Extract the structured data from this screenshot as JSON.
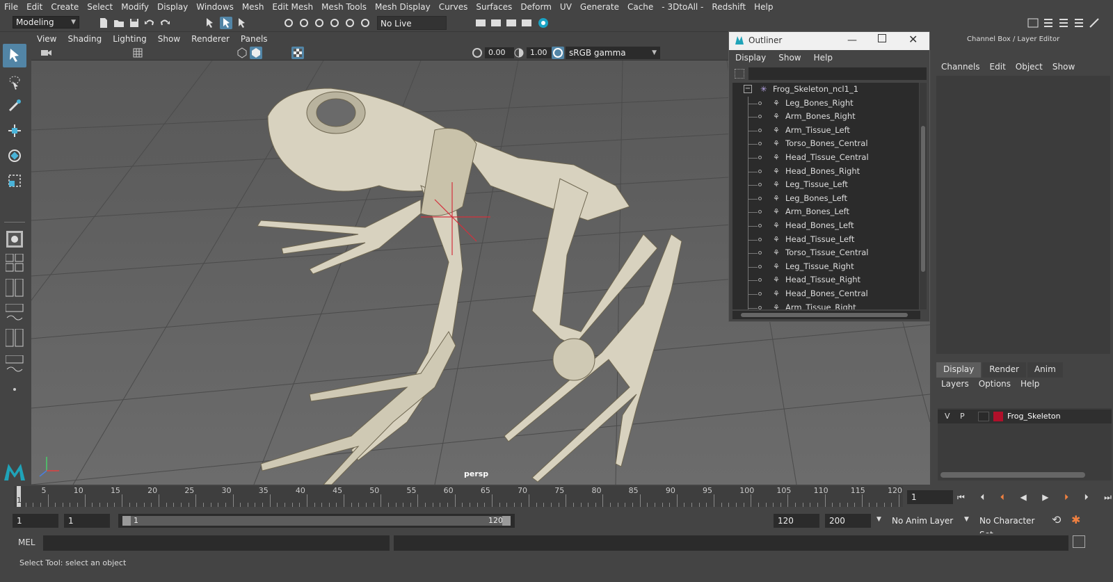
{
  "menubar": [
    "File",
    "Edit",
    "Create",
    "Select",
    "Modify",
    "Display",
    "Windows",
    "Mesh",
    "Edit Mesh",
    "Mesh Tools",
    "Mesh Display",
    "Curves",
    "Surfaces",
    "Deform",
    "UV",
    "Generate",
    "Cache",
    "- 3DtoAll -",
    "Redshift",
    "Help"
  ],
  "shelf": {
    "mode": "Modeling",
    "live_surface": "No Live Surface"
  },
  "viewport": {
    "menu": [
      "View",
      "Shading",
      "Lighting",
      "Show",
      "Renderer",
      "Panels"
    ],
    "exposure": "0.00",
    "gamma": "1.00",
    "color_space": "sRGB gamma",
    "camera_label": "persp"
  },
  "outliner": {
    "title": "Outliner",
    "menu": [
      "Display",
      "Show",
      "Help"
    ],
    "root": "Frog_Skeleton_ncl1_1",
    "items": [
      "Leg_Bones_Right",
      "Arm_Bones_Right",
      "Arm_Tissue_Left",
      "Torso_Bones_Central",
      "Head_Tissue_Central",
      "Head_Bones_Right",
      "Leg_Tissue_Left",
      "Leg_Bones_Left",
      "Arm_Bones_Left",
      "Head_Bones_Left",
      "Head_Tissue_Left",
      "Torso_Tissue_Central",
      "Leg_Tissue_Right",
      "Head_Tissue_Right",
      "Head_Bones_Central",
      "Arm_Tissue_Right"
    ]
  },
  "channel_box": {
    "title": "Channel Box / Layer Editor",
    "menu": [
      "Channels",
      "Edit",
      "Object",
      "Show"
    ],
    "tabs": [
      "Display",
      "Render",
      "Anim"
    ],
    "layer_menu": [
      "Layers",
      "Options",
      "Help"
    ],
    "layer": {
      "v": "V",
      "p": "P",
      "name": "Frog_Skeleton",
      "color": "#b0102a"
    }
  },
  "timeline": {
    "ticks": [
      "5",
      "10",
      "15",
      "20",
      "25",
      "30",
      "35",
      "40",
      "45",
      "50",
      "55",
      "60",
      "65",
      "70",
      "75",
      "80",
      "85",
      "90",
      "95",
      "100",
      "105",
      "110",
      "115",
      "120"
    ],
    "start_mark": "1",
    "current_frame": "1"
  },
  "range": {
    "start": "1",
    "playback_start": "1",
    "slider_start": "1",
    "slider_end": "120",
    "playback_end": "120",
    "end": "200",
    "anim_layer": "No Anim Layer",
    "character_set": "No Character Set"
  },
  "command": {
    "label": "MEL"
  },
  "status": {
    "text": "Select Tool: select an object"
  },
  "colors": {
    "accent": "#5285a6",
    "bg": "#444444",
    "viewport": "#6a6a6a"
  }
}
